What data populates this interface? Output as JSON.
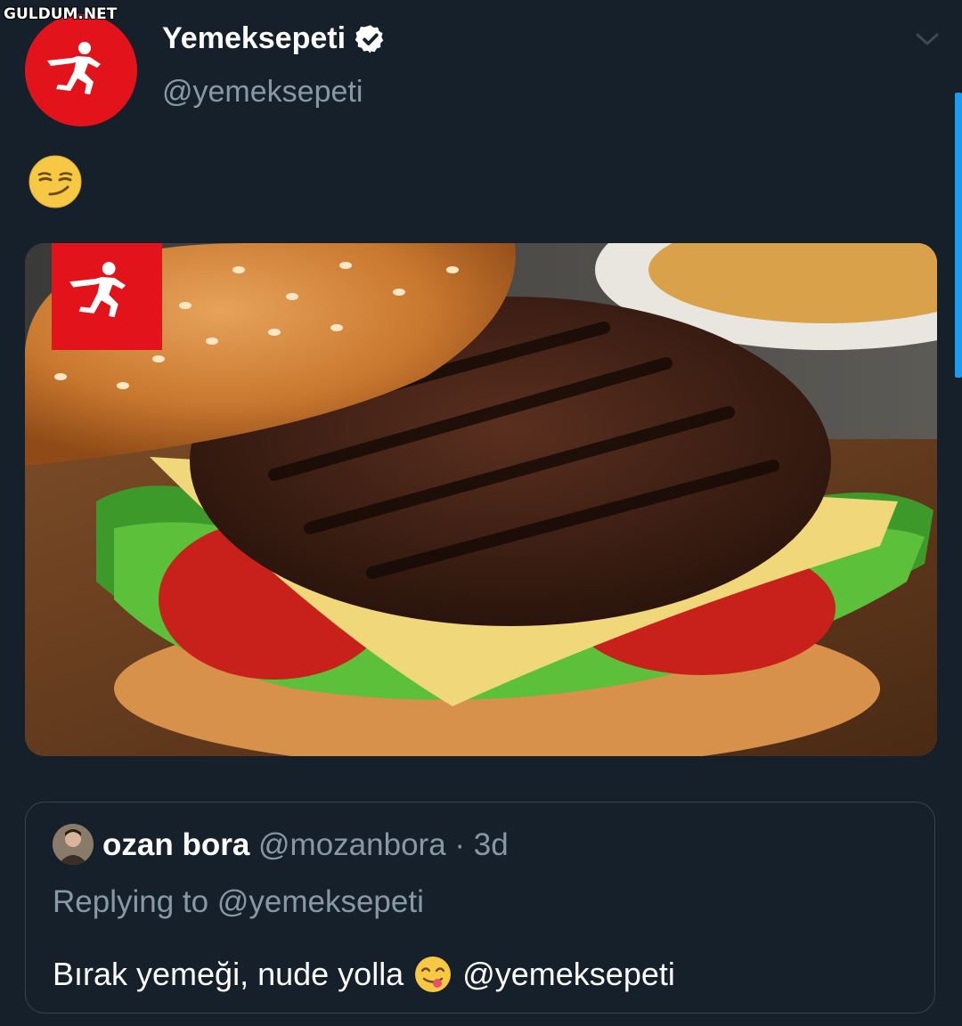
{
  "watermark": "GULDUM.NET",
  "tweet": {
    "display_name": "Yemeksepeti",
    "handle": "@yemeksepeti",
    "verified": true,
    "body_emoji": "smirking-face",
    "media_alt_icon": "burger-photo"
  },
  "quoted": {
    "name": "ozan bora",
    "handle": "@mozanbora",
    "separator": "·",
    "time": "3d",
    "replying_to_prefix": "Replying to",
    "replying_to_handle": "@yemeksepeti",
    "text_before": "Bırak yemeği, nude yolla",
    "text_emoji": "face-savoring-food",
    "text_after": "@yemeksepeti"
  },
  "colors": {
    "background": "#15202b",
    "secondary_text": "#8899a6",
    "brand_red": "#e3131b",
    "border": "#38444d"
  }
}
